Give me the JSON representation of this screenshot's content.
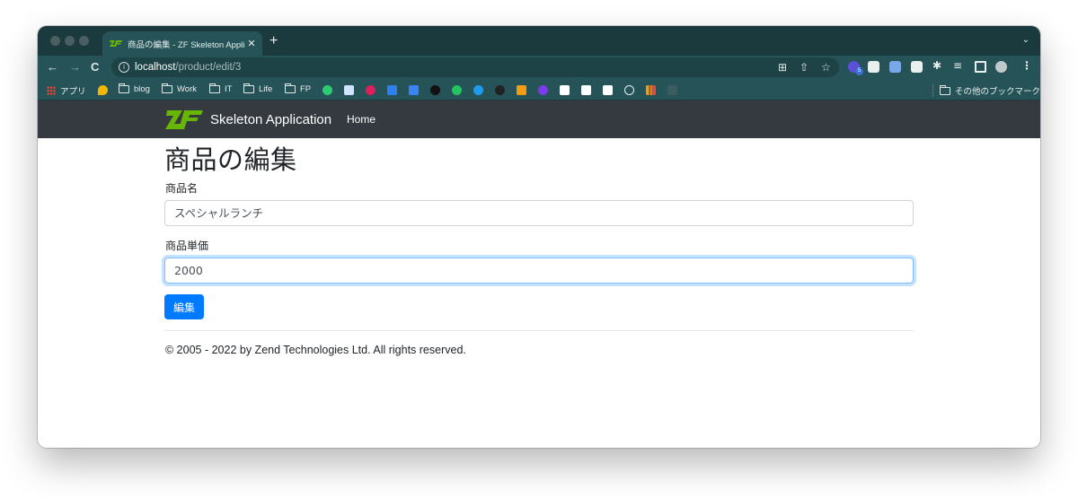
{
  "browser": {
    "tab_title": "商品の編集 - ZF Skeleton Applic",
    "tab_close": "✕",
    "new_tab": "+",
    "tab_menu": "⌄",
    "nav": {
      "back": "←",
      "forward": "→",
      "reload": "C"
    },
    "url_host": "localhost",
    "url_path": "/product/edit/3",
    "url_info_icon": "i",
    "omnibox_icons": [
      "translate-icon",
      "share-icon",
      "star-icon"
    ],
    "extensions_badge": "5",
    "bookmarks": {
      "apps": "アプリ",
      "folders": [
        "blog",
        "Work",
        "IT",
        "Life",
        "FP"
      ],
      "other": "その他のブックマーク"
    }
  },
  "navbar": {
    "brand": "Skeleton Application",
    "links": [
      "Home"
    ]
  },
  "page": {
    "heading": "商品の編集",
    "fields": [
      {
        "label": "商品名",
        "value": "スペシャルランチ"
      },
      {
        "label": "商品単価",
        "value": "2000"
      }
    ],
    "submit_label": "編集",
    "footer": "© 2005 - 2022 by Zend Technologies Ltd. All rights reserved."
  },
  "colors": {
    "navbar_bg": "#343a40",
    "primary": "#007bff",
    "zf_green": "#68b604",
    "chrome_toolbar": "#265357",
    "chrome_tabstrip": "#1b3a3d"
  }
}
